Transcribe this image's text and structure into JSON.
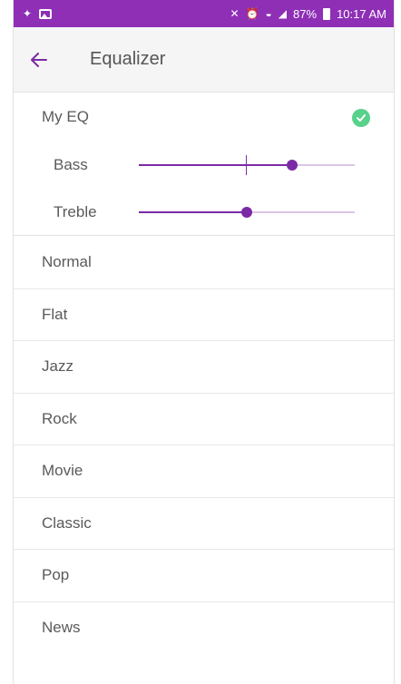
{
  "status_bar": {
    "battery_text": "87%",
    "time": "10:17 AM",
    "background_color": "#8e2fb6"
  },
  "app_bar": {
    "title": "Equalizer",
    "back_icon": "arrow-left-icon",
    "accent_color": "#7b2aa6"
  },
  "my_eq": {
    "title": "My EQ",
    "selected": true,
    "selected_icon": "check-circle-icon",
    "selected_color": "#58d18b",
    "sliders": [
      {
        "label": "Bass",
        "value_fraction": 0.71
      },
      {
        "label": "Treble",
        "value_fraction": 0.5
      }
    ]
  },
  "presets": [
    "Normal",
    "Flat",
    "Jazz",
    "Rock",
    "Movie",
    "Classic",
    "Pop",
    "News"
  ]
}
